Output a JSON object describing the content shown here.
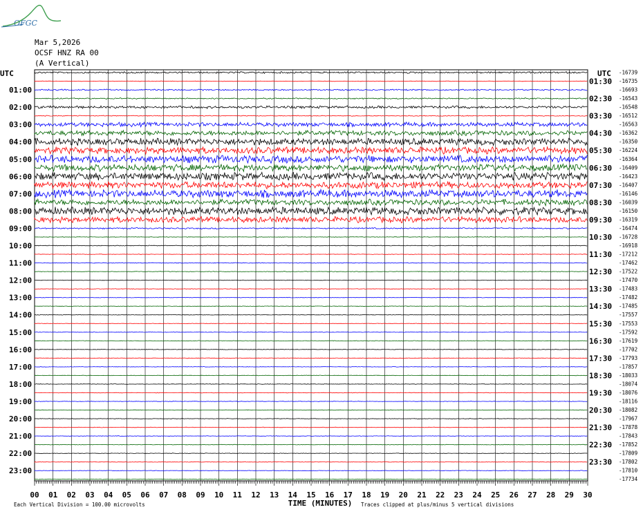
{
  "logo": {
    "text": "OFGC",
    "color": "#2f6fa8"
  },
  "header": {
    "date": "Mar 5,2026",
    "station": "OCSF HNZ RA 00",
    "component": "(A Vertical)"
  },
  "colors": {
    "trace_cycle": [
      "#000000",
      "#ff0000",
      "#0000ff",
      "#006400"
    ],
    "grid": "#000000"
  },
  "chart_data": {
    "type": "line",
    "xlabel": "TIME (MINUTES)",
    "left_axis_title": "UTC",
    "right_axis_title": "UTC",
    "xlim": [
      0,
      30
    ],
    "x_ticks": [
      "00",
      "01",
      "02",
      "03",
      "04",
      "05",
      "06",
      "07",
      "08",
      "09",
      "10",
      "11",
      "12",
      "13",
      "14",
      "15",
      "16",
      "17",
      "18",
      "19",
      "20",
      "21",
      "22",
      "23",
      "24",
      "25",
      "26",
      "27",
      "28",
      "29",
      "30"
    ],
    "left_labels": [
      "01:00",
      "02:00",
      "03:00",
      "04:00",
      "05:00",
      "06:00",
      "07:00",
      "08:00",
      "09:00",
      "10:00",
      "11:00",
      "12:00",
      "13:00",
      "14:00",
      "15:00",
      "16:00",
      "17:00",
      "18:00",
      "19:00",
      "20:00",
      "21:00",
      "22:00",
      "23:00"
    ],
    "right_labels": [
      "01:30",
      "02:30",
      "03:30",
      "04:30",
      "05:30",
      "06:30",
      "07:30",
      "08:30",
      "09:30",
      "10:30",
      "11:30",
      "12:30",
      "13:30",
      "14:30",
      "15:30",
      "16:30",
      "17:30",
      "18:30",
      "19:30",
      "20:30",
      "21:30",
      "22:30",
      "23:30"
    ],
    "trace_offsets": [
      "-16739",
      "-16735",
      "-16693",
      "-16543",
      "-16548",
      "-16512",
      "-16563",
      "-16362",
      "-16350",
      "-16224",
      "-16364",
      "-16409",
      "-16423",
      "-16407",
      "-16146",
      "-16039",
      "-16150",
      "-16319",
      "-16474",
      "-16728",
      "-16918",
      "-17212",
      "-17462",
      "-17522",
      "-17470",
      "-17483",
      "-17482",
      "-17485",
      "-17557",
      "-17553",
      "-17592",
      "-17619",
      "-17702",
      "-17793",
      "-17857",
      "-18033",
      "-18074",
      "-18076",
      "-18116",
      "-18082",
      "-17967",
      "-17878",
      "-17843",
      "-17852",
      "-17809",
      "-17802",
      "-17810",
      "-17734"
    ],
    "trace_activity": [
      1,
      0.3,
      0.8,
      0.7,
      1.5,
      0.5,
      2.5,
      3,
      4,
      4,
      4.5,
      4,
      4.5,
      4,
      4.5,
      3.5,
      4.5,
      3.5,
      0.8,
      0.3,
      0.4,
      0.3,
      0.4,
      0.3,
      0.3,
      0.3,
      0.3,
      0.3,
      0.3,
      0.3,
      0.3,
      0.3,
      0.3,
      0.3,
      0.3,
      0.3,
      0.3,
      0.3,
      0.3,
      0.3,
      0.3,
      0.3,
      0.3,
      0.3,
      0.3,
      0.3,
      0.3,
      0.3
    ],
    "footer_left": "Each Vertical Division = 100.00 microvolts",
    "footer_right": "Traces clipped at plus/minus 5 vertical divisions"
  }
}
